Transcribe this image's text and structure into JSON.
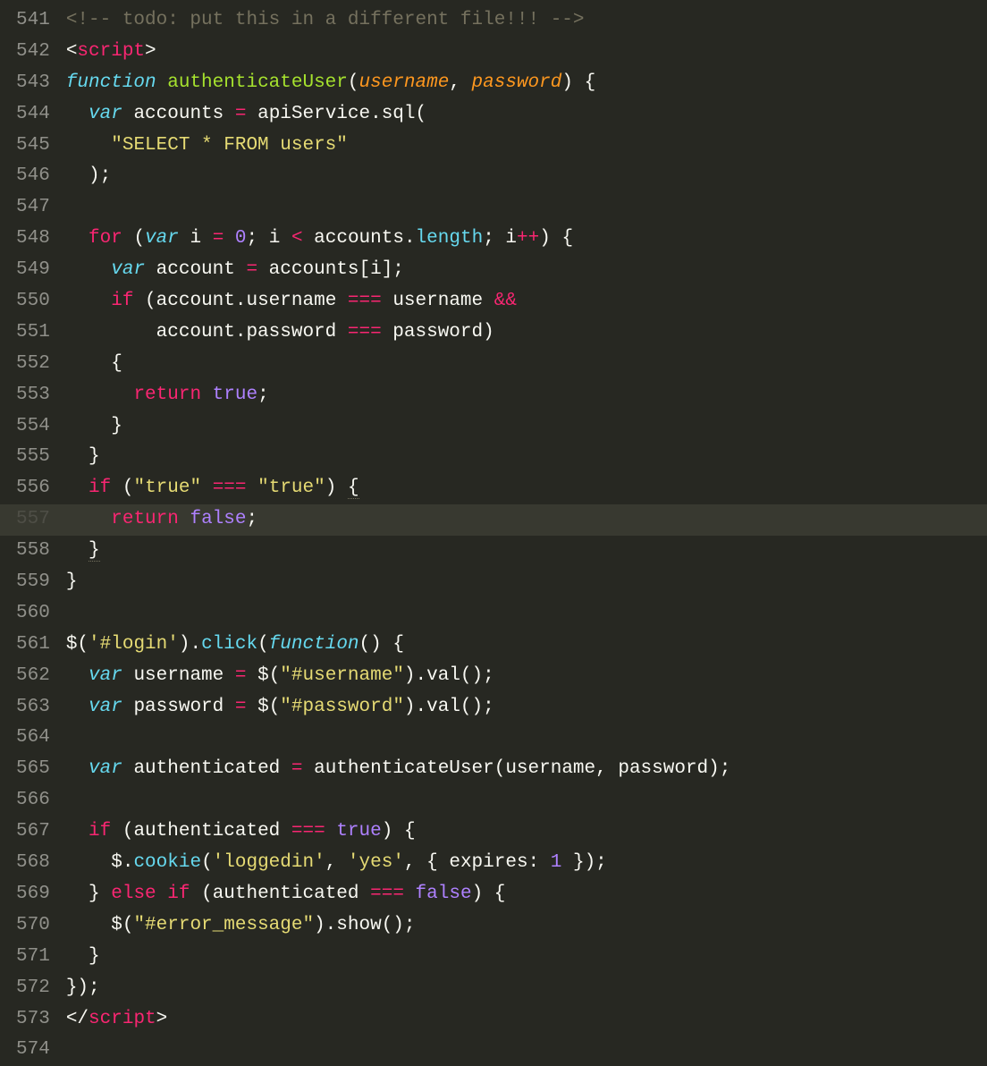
{
  "gutter": {
    "start": 541,
    "end": 574
  },
  "highlighted_line": 557,
  "lines": {
    "541": [
      {
        "cls": "c-comment",
        "t": "<!-- todo: put this in a different file!!! -->"
      }
    ],
    "542": [
      {
        "cls": "c-punct",
        "t": "<"
      },
      {
        "cls": "c-tag",
        "t": "script"
      },
      {
        "cls": "c-punct",
        "t": ">"
      }
    ],
    "543": [
      {
        "cls": "c-keyword",
        "t": "function"
      },
      {
        "cls": "c-default",
        "t": " "
      },
      {
        "cls": "c-funcname",
        "t": "authenticateUser"
      },
      {
        "cls": "c-punct",
        "t": "("
      },
      {
        "cls": "c-param",
        "t": "username"
      },
      {
        "cls": "c-punct",
        "t": ", "
      },
      {
        "cls": "c-param",
        "t": "password"
      },
      {
        "cls": "c-punct",
        "t": ") {"
      }
    ],
    "544": [
      {
        "cls": "c-default",
        "t": "  "
      },
      {
        "cls": "c-keyword",
        "t": "var"
      },
      {
        "cls": "c-default",
        "t": " accounts "
      },
      {
        "cls": "c-op",
        "t": "="
      },
      {
        "cls": "c-default",
        "t": " apiService.sql("
      }
    ],
    "545": [
      {
        "cls": "c-default",
        "t": "    "
      },
      {
        "cls": "c-string",
        "t": "\"SELECT * FROM users\""
      }
    ],
    "546": [
      {
        "cls": "c-default",
        "t": "  );"
      }
    ],
    "547": [
      {
        "cls": "c-default",
        "t": ""
      }
    ],
    "548": [
      {
        "cls": "c-default",
        "t": "  "
      },
      {
        "cls": "c-control",
        "t": "for"
      },
      {
        "cls": "c-default",
        "t": " ("
      },
      {
        "cls": "c-keyword",
        "t": "var"
      },
      {
        "cls": "c-default",
        "t": " i "
      },
      {
        "cls": "c-op",
        "t": "="
      },
      {
        "cls": "c-default",
        "t": " "
      },
      {
        "cls": "c-number",
        "t": "0"
      },
      {
        "cls": "c-default",
        "t": "; i "
      },
      {
        "cls": "c-op",
        "t": "<"
      },
      {
        "cls": "c-default",
        "t": " accounts."
      },
      {
        "cls": "c-call",
        "t": "length"
      },
      {
        "cls": "c-default",
        "t": "; i"
      },
      {
        "cls": "c-op",
        "t": "++"
      },
      {
        "cls": "c-default",
        "t": ") {"
      }
    ],
    "549": [
      {
        "cls": "c-default",
        "t": "    "
      },
      {
        "cls": "c-keyword",
        "t": "var"
      },
      {
        "cls": "c-default",
        "t": " account "
      },
      {
        "cls": "c-op",
        "t": "="
      },
      {
        "cls": "c-default",
        "t": " accounts[i];"
      }
    ],
    "550": [
      {
        "cls": "c-default",
        "t": "    "
      },
      {
        "cls": "c-control",
        "t": "if"
      },
      {
        "cls": "c-default",
        "t": " (account.username "
      },
      {
        "cls": "c-op",
        "t": "==="
      },
      {
        "cls": "c-default",
        "t": " username "
      },
      {
        "cls": "c-op",
        "t": "&&"
      }
    ],
    "551": [
      {
        "cls": "c-default",
        "t": "        account.password "
      },
      {
        "cls": "c-op",
        "t": "==="
      },
      {
        "cls": "c-default",
        "t": " password)"
      }
    ],
    "552": [
      {
        "cls": "c-default",
        "t": "    {"
      }
    ],
    "553": [
      {
        "cls": "c-default",
        "t": "      "
      },
      {
        "cls": "c-control",
        "t": "return"
      },
      {
        "cls": "c-default",
        "t": " "
      },
      {
        "cls": "c-const",
        "t": "true"
      },
      {
        "cls": "c-default",
        "t": ";"
      }
    ],
    "554": [
      {
        "cls": "c-default",
        "t": "    }"
      }
    ],
    "555": [
      {
        "cls": "c-default",
        "t": "  }"
      }
    ],
    "556": [
      {
        "cls": "c-default",
        "t": "  "
      },
      {
        "cls": "c-control",
        "t": "if"
      },
      {
        "cls": "c-default",
        "t": " ("
      },
      {
        "cls": "c-string",
        "t": "\"true\""
      },
      {
        "cls": "c-default",
        "t": " "
      },
      {
        "cls": "c-op",
        "t": "==="
      },
      {
        "cls": "c-default",
        "t": " "
      },
      {
        "cls": "c-string",
        "t": "\"true\""
      },
      {
        "cls": "c-default",
        "t": ") "
      },
      {
        "cls": "c-default underline",
        "t": "{"
      }
    ],
    "557": [
      {
        "cls": "c-default",
        "t": "    "
      },
      {
        "cls": "c-control",
        "t": "return"
      },
      {
        "cls": "c-default",
        "t": " "
      },
      {
        "cls": "c-const",
        "t": "false"
      },
      {
        "cls": "c-default",
        "t": ";"
      }
    ],
    "558": [
      {
        "cls": "c-default",
        "t": "  "
      },
      {
        "cls": "c-default underline",
        "t": "}"
      }
    ],
    "559": [
      {
        "cls": "c-default",
        "t": "}"
      }
    ],
    "560": [
      {
        "cls": "c-default",
        "t": ""
      }
    ],
    "561": [
      {
        "cls": "c-default",
        "t": "$("
      },
      {
        "cls": "c-string",
        "t": "'#login'"
      },
      {
        "cls": "c-default",
        "t": ")."
      },
      {
        "cls": "c-call",
        "t": "click"
      },
      {
        "cls": "c-default",
        "t": "("
      },
      {
        "cls": "c-keyword",
        "t": "function"
      },
      {
        "cls": "c-default",
        "t": "() {"
      }
    ],
    "562": [
      {
        "cls": "c-default",
        "t": "  "
      },
      {
        "cls": "c-keyword",
        "t": "var"
      },
      {
        "cls": "c-default",
        "t": " username "
      },
      {
        "cls": "c-op",
        "t": "="
      },
      {
        "cls": "c-default",
        "t": " $("
      },
      {
        "cls": "c-string",
        "t": "\"#username\""
      },
      {
        "cls": "c-default",
        "t": ").val();"
      }
    ],
    "563": [
      {
        "cls": "c-default",
        "t": "  "
      },
      {
        "cls": "c-keyword",
        "t": "var"
      },
      {
        "cls": "c-default",
        "t": " password "
      },
      {
        "cls": "c-op",
        "t": "="
      },
      {
        "cls": "c-default",
        "t": " $("
      },
      {
        "cls": "c-string",
        "t": "\"#password\""
      },
      {
        "cls": "c-default",
        "t": ").val();"
      }
    ],
    "564": [
      {
        "cls": "c-default",
        "t": ""
      }
    ],
    "565": [
      {
        "cls": "c-default",
        "t": "  "
      },
      {
        "cls": "c-keyword",
        "t": "var"
      },
      {
        "cls": "c-default",
        "t": " authenticated "
      },
      {
        "cls": "c-op",
        "t": "="
      },
      {
        "cls": "c-default",
        "t": " authenticateUser(username, password);"
      }
    ],
    "566": [
      {
        "cls": "c-default",
        "t": ""
      }
    ],
    "567": [
      {
        "cls": "c-default",
        "t": "  "
      },
      {
        "cls": "c-control",
        "t": "if"
      },
      {
        "cls": "c-default",
        "t": " (authenticated "
      },
      {
        "cls": "c-op",
        "t": "==="
      },
      {
        "cls": "c-default",
        "t": " "
      },
      {
        "cls": "c-const",
        "t": "true"
      },
      {
        "cls": "c-default",
        "t": ") {"
      }
    ],
    "568": [
      {
        "cls": "c-default",
        "t": "    $."
      },
      {
        "cls": "c-call",
        "t": "cookie"
      },
      {
        "cls": "c-default",
        "t": "("
      },
      {
        "cls": "c-string",
        "t": "'loggedin'"
      },
      {
        "cls": "c-default",
        "t": ", "
      },
      {
        "cls": "c-string",
        "t": "'yes'"
      },
      {
        "cls": "c-default",
        "t": ", { expires: "
      },
      {
        "cls": "c-number",
        "t": "1"
      },
      {
        "cls": "c-default",
        "t": " });"
      }
    ],
    "569": [
      {
        "cls": "c-default",
        "t": "  } "
      },
      {
        "cls": "c-control",
        "t": "else"
      },
      {
        "cls": "c-default",
        "t": " "
      },
      {
        "cls": "c-control",
        "t": "if"
      },
      {
        "cls": "c-default",
        "t": " (authenticated "
      },
      {
        "cls": "c-op",
        "t": "==="
      },
      {
        "cls": "c-default",
        "t": " "
      },
      {
        "cls": "c-const",
        "t": "false"
      },
      {
        "cls": "c-default",
        "t": ") {"
      }
    ],
    "570": [
      {
        "cls": "c-default",
        "t": "    $("
      },
      {
        "cls": "c-string",
        "t": "\"#error_message\""
      },
      {
        "cls": "c-default",
        "t": ").show();"
      }
    ],
    "571": [
      {
        "cls": "c-default",
        "t": "  }"
      }
    ],
    "572": [
      {
        "cls": "c-default",
        "t": "});"
      }
    ],
    "573": [
      {
        "cls": "c-punct",
        "t": "</"
      },
      {
        "cls": "c-tag",
        "t": "script"
      },
      {
        "cls": "c-punct",
        "t": ">"
      }
    ],
    "574": [
      {
        "cls": "c-default",
        "t": ""
      }
    ]
  }
}
